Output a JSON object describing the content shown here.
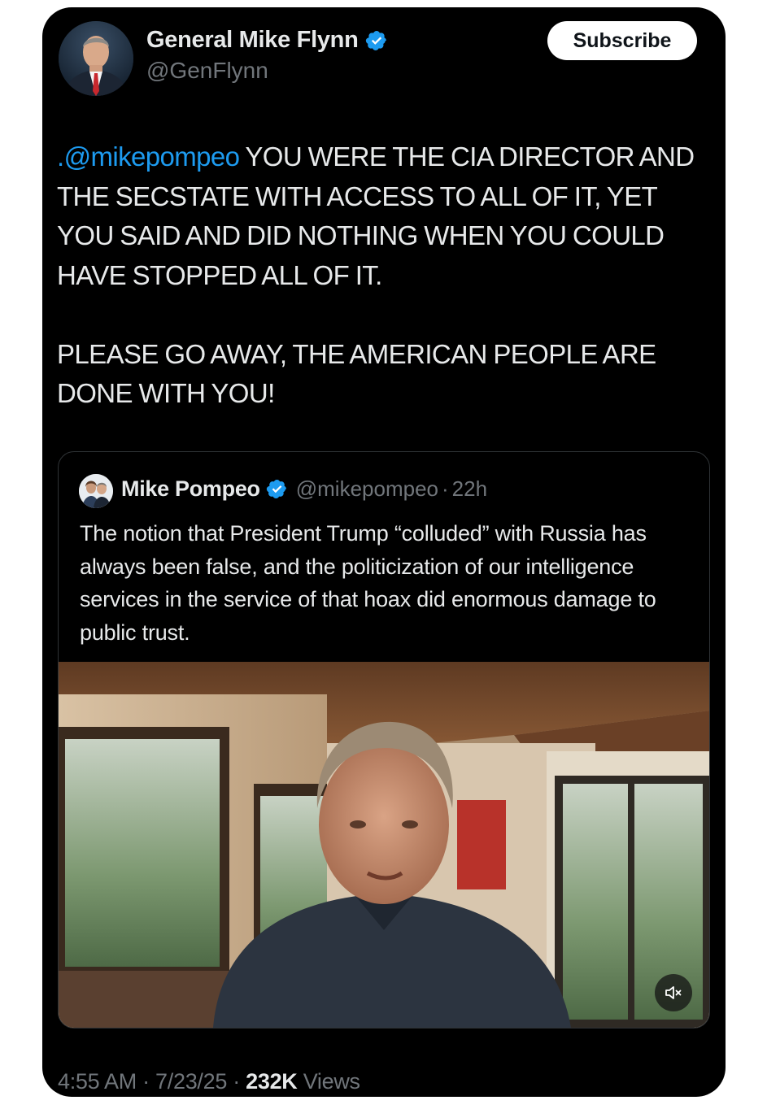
{
  "post": {
    "author": {
      "name": "General Mike Flynn",
      "handle": "@GenFlynn",
      "verified_icon": "verified-badge-icon"
    },
    "subscribe_label": "Subscribe",
    "mention": ".@mikepompeo",
    "text_part1": " YOU WERE THE CIA DIRECTOR AND THE SECSTATE WITH ACCESS TO ALL OF IT, YET YOU SAID AND DID NOTHING WHEN YOU COULD HAVE STOPPED ALL OF IT.",
    "text_part2": "PLEASE GO AWAY, THE AMERICAN PEOPLE ARE DONE WITH YOU!",
    "timestamp": "4:55 AM · 7/23/25 · ",
    "views_count": "232K",
    "views_label": " Views"
  },
  "quoted_post": {
    "author_name": "Mike Pompeo",
    "handle": "@mikepompeo",
    "separator": "·",
    "time": "22h",
    "text": "The notion that President Trump “colluded” with Russia has always been false, and the politicization of our intelligence services in the service of that hoax did enormous damage to public trust.",
    "media": {
      "type": "video",
      "mute_icon": "speaker-muted-icon"
    }
  },
  "colors": {
    "background": "#000000",
    "text": "#e7e9ea",
    "secondary_text": "#71767b",
    "link": "#1d9bf0",
    "verified": "#1d9bf0",
    "border": "#2f3336"
  }
}
